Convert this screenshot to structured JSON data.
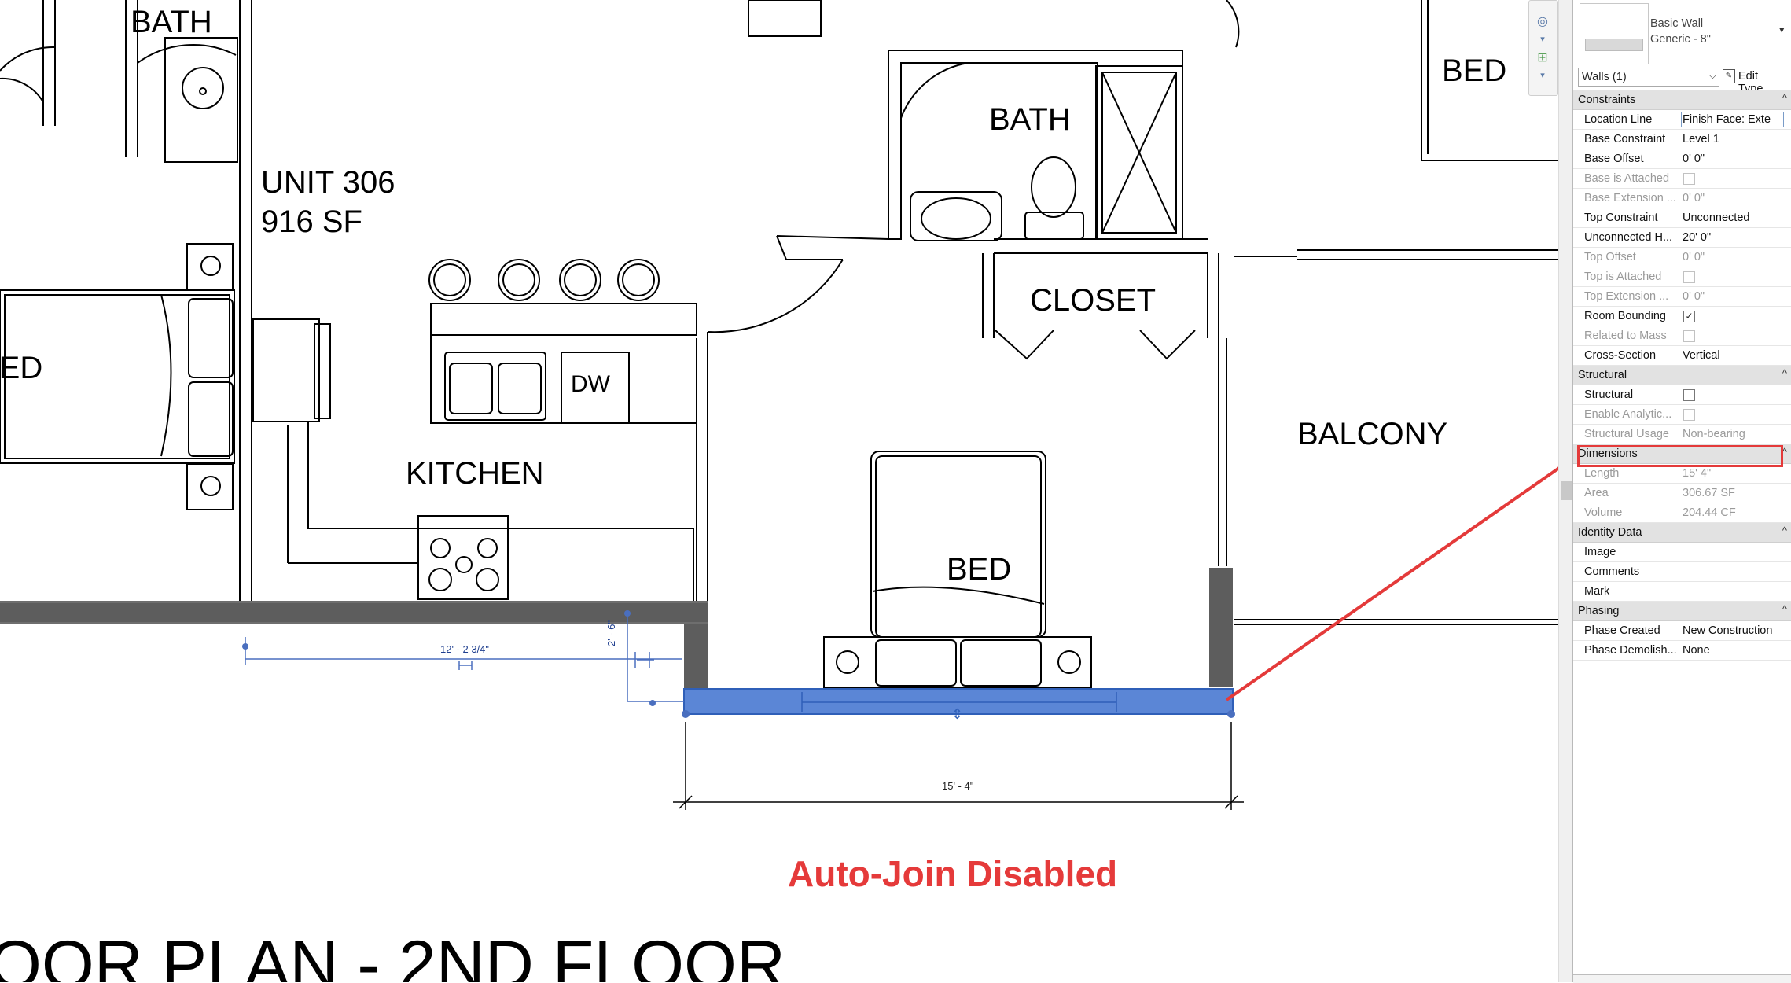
{
  "drawing": {
    "rooms": [
      {
        "id": "bath-left",
        "label": "BATH"
      },
      {
        "id": "unit",
        "label": "UNIT 306"
      },
      {
        "id": "unit-area",
        "label": "916  SF"
      },
      {
        "id": "bed-left",
        "label": "BED"
      },
      {
        "id": "kitchen",
        "label": "KITCHEN"
      },
      {
        "id": "dw",
        "label": "DW"
      },
      {
        "id": "bath-center",
        "label": "BATH"
      },
      {
        "id": "closet",
        "label": "CLOSET"
      },
      {
        "id": "balcony",
        "label": "BALCONY"
      },
      {
        "id": "bed-center",
        "label": "BED"
      },
      {
        "id": "bed-right",
        "label": "BED"
      }
    ],
    "dimensions": {
      "horizontal_temp": "12' - 2 3/4\"",
      "vertical_temp": "2' - 6\"",
      "wall_length": "15' - 4\""
    },
    "annotation": {
      "text": "Auto-Join Disabled",
      "color": "#e53a3a"
    },
    "sheet_title": "OOR PLAN - 2ND FLOOR",
    "selection_color": "#5b86d6"
  },
  "properties": {
    "type_family": "Basic Wall",
    "type_name": "Generic - 8\"",
    "filter": "Walls (1)",
    "edit_type": "Edit Type",
    "categories": [
      {
        "name": "Constraints",
        "rows": [
          {
            "key": "Location Line",
            "value": "Finish Face: Exte",
            "kind": "input"
          },
          {
            "key": "Base Constraint",
            "value": "Level 1",
            "kind": "text"
          },
          {
            "key": "Base Offset",
            "value": "0'  0\"",
            "kind": "text"
          },
          {
            "key": "Base is Attached",
            "value": "",
            "kind": "check",
            "checked": false,
            "disabled": true
          },
          {
            "key": "Base Extension ...",
            "value": "0'  0\"",
            "kind": "text",
            "disabled": true
          },
          {
            "key": "Top Constraint",
            "value": "Unconnected",
            "kind": "text"
          },
          {
            "key": "Unconnected H...",
            "value": "20'  0\"",
            "kind": "text"
          },
          {
            "key": "Top Offset",
            "value": "0'  0\"",
            "kind": "text",
            "disabled": true
          },
          {
            "key": "Top is Attached",
            "value": "",
            "kind": "check",
            "checked": false,
            "disabled": true
          },
          {
            "key": "Top Extension ...",
            "value": "0'  0\"",
            "kind": "text",
            "disabled": true
          },
          {
            "key": "Room Bounding",
            "value": "",
            "kind": "check",
            "checked": true
          },
          {
            "key": "Related to Mass",
            "value": "",
            "kind": "check",
            "checked": false,
            "disabled": true
          },
          {
            "key": "Cross-Section",
            "value": "Vertical",
            "kind": "text"
          }
        ]
      },
      {
        "name": "Structural",
        "rows": [
          {
            "key": "Structural",
            "value": "",
            "kind": "check",
            "checked": false
          },
          {
            "key": "Enable Analytic...",
            "value": "",
            "kind": "check",
            "checked": false,
            "disabled": true
          },
          {
            "key": "Structural Usage",
            "value": "Non-bearing",
            "kind": "text",
            "disabled": true
          }
        ]
      },
      {
        "name": "Dimensions",
        "rows": [
          {
            "key": "Length",
            "value": "15'  4\"",
            "kind": "text",
            "disabled": true
          },
          {
            "key": "Area",
            "value": "306.67 SF",
            "kind": "text",
            "disabled": true
          },
          {
            "key": "Volume",
            "value": "204.44 CF",
            "kind": "text",
            "disabled": true
          }
        ]
      },
      {
        "name": "Identity Data",
        "rows": [
          {
            "key": "Image",
            "value": "",
            "kind": "text"
          },
          {
            "key": "Comments",
            "value": "",
            "kind": "text"
          },
          {
            "key": "Mark",
            "value": "",
            "kind": "text"
          }
        ]
      },
      {
        "name": "Phasing",
        "rows": [
          {
            "key": "Phase Created",
            "value": "New Construction",
            "kind": "text"
          },
          {
            "key": "Phase Demolish...",
            "value": "None",
            "kind": "text"
          }
        ]
      }
    ],
    "collapse_glyph": "^",
    "highlight_color": "#e43a3a"
  }
}
